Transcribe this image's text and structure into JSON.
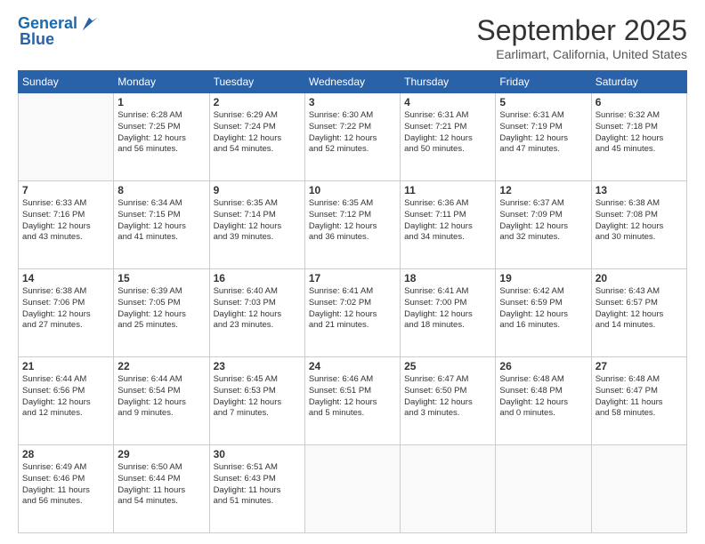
{
  "header": {
    "logo_line1": "General",
    "logo_line2": "Blue",
    "title": "September 2025",
    "subtitle": "Earlimart, California, United States"
  },
  "calendar": {
    "days_of_week": [
      "Sunday",
      "Monday",
      "Tuesday",
      "Wednesday",
      "Thursday",
      "Friday",
      "Saturday"
    ],
    "weeks": [
      [
        {
          "day": "",
          "info": ""
        },
        {
          "day": "1",
          "info": "Sunrise: 6:28 AM\nSunset: 7:25 PM\nDaylight: 12 hours\nand 56 minutes."
        },
        {
          "day": "2",
          "info": "Sunrise: 6:29 AM\nSunset: 7:24 PM\nDaylight: 12 hours\nand 54 minutes."
        },
        {
          "day": "3",
          "info": "Sunrise: 6:30 AM\nSunset: 7:22 PM\nDaylight: 12 hours\nand 52 minutes."
        },
        {
          "day": "4",
          "info": "Sunrise: 6:31 AM\nSunset: 7:21 PM\nDaylight: 12 hours\nand 50 minutes."
        },
        {
          "day": "5",
          "info": "Sunrise: 6:31 AM\nSunset: 7:19 PM\nDaylight: 12 hours\nand 47 minutes."
        },
        {
          "day": "6",
          "info": "Sunrise: 6:32 AM\nSunset: 7:18 PM\nDaylight: 12 hours\nand 45 minutes."
        }
      ],
      [
        {
          "day": "7",
          "info": "Sunrise: 6:33 AM\nSunset: 7:16 PM\nDaylight: 12 hours\nand 43 minutes."
        },
        {
          "day": "8",
          "info": "Sunrise: 6:34 AM\nSunset: 7:15 PM\nDaylight: 12 hours\nand 41 minutes."
        },
        {
          "day": "9",
          "info": "Sunrise: 6:35 AM\nSunset: 7:14 PM\nDaylight: 12 hours\nand 39 minutes."
        },
        {
          "day": "10",
          "info": "Sunrise: 6:35 AM\nSunset: 7:12 PM\nDaylight: 12 hours\nand 36 minutes."
        },
        {
          "day": "11",
          "info": "Sunrise: 6:36 AM\nSunset: 7:11 PM\nDaylight: 12 hours\nand 34 minutes."
        },
        {
          "day": "12",
          "info": "Sunrise: 6:37 AM\nSunset: 7:09 PM\nDaylight: 12 hours\nand 32 minutes."
        },
        {
          "day": "13",
          "info": "Sunrise: 6:38 AM\nSunset: 7:08 PM\nDaylight: 12 hours\nand 30 minutes."
        }
      ],
      [
        {
          "day": "14",
          "info": "Sunrise: 6:38 AM\nSunset: 7:06 PM\nDaylight: 12 hours\nand 27 minutes."
        },
        {
          "day": "15",
          "info": "Sunrise: 6:39 AM\nSunset: 7:05 PM\nDaylight: 12 hours\nand 25 minutes."
        },
        {
          "day": "16",
          "info": "Sunrise: 6:40 AM\nSunset: 7:03 PM\nDaylight: 12 hours\nand 23 minutes."
        },
        {
          "day": "17",
          "info": "Sunrise: 6:41 AM\nSunset: 7:02 PM\nDaylight: 12 hours\nand 21 minutes."
        },
        {
          "day": "18",
          "info": "Sunrise: 6:41 AM\nSunset: 7:00 PM\nDaylight: 12 hours\nand 18 minutes."
        },
        {
          "day": "19",
          "info": "Sunrise: 6:42 AM\nSunset: 6:59 PM\nDaylight: 12 hours\nand 16 minutes."
        },
        {
          "day": "20",
          "info": "Sunrise: 6:43 AM\nSunset: 6:57 PM\nDaylight: 12 hours\nand 14 minutes."
        }
      ],
      [
        {
          "day": "21",
          "info": "Sunrise: 6:44 AM\nSunset: 6:56 PM\nDaylight: 12 hours\nand 12 minutes."
        },
        {
          "day": "22",
          "info": "Sunrise: 6:44 AM\nSunset: 6:54 PM\nDaylight: 12 hours\nand 9 minutes."
        },
        {
          "day": "23",
          "info": "Sunrise: 6:45 AM\nSunset: 6:53 PM\nDaylight: 12 hours\nand 7 minutes."
        },
        {
          "day": "24",
          "info": "Sunrise: 6:46 AM\nSunset: 6:51 PM\nDaylight: 12 hours\nand 5 minutes."
        },
        {
          "day": "25",
          "info": "Sunrise: 6:47 AM\nSunset: 6:50 PM\nDaylight: 12 hours\nand 3 minutes."
        },
        {
          "day": "26",
          "info": "Sunrise: 6:48 AM\nSunset: 6:48 PM\nDaylight: 12 hours\nand 0 minutes."
        },
        {
          "day": "27",
          "info": "Sunrise: 6:48 AM\nSunset: 6:47 PM\nDaylight: 11 hours\nand 58 minutes."
        }
      ],
      [
        {
          "day": "28",
          "info": "Sunrise: 6:49 AM\nSunset: 6:46 PM\nDaylight: 11 hours\nand 56 minutes."
        },
        {
          "day": "29",
          "info": "Sunrise: 6:50 AM\nSunset: 6:44 PM\nDaylight: 11 hours\nand 54 minutes."
        },
        {
          "day": "30",
          "info": "Sunrise: 6:51 AM\nSunset: 6:43 PM\nDaylight: 11 hours\nand 51 minutes."
        },
        {
          "day": "",
          "info": ""
        },
        {
          "day": "",
          "info": ""
        },
        {
          "day": "",
          "info": ""
        },
        {
          "day": "",
          "info": ""
        }
      ]
    ]
  }
}
